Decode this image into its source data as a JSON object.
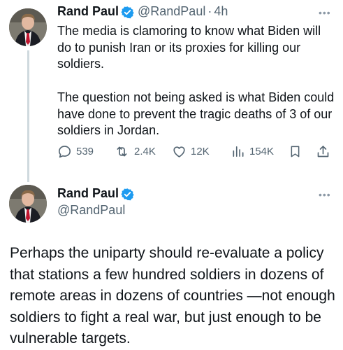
{
  "tweet1": {
    "name": "Rand Paul",
    "handle": "@RandPaul",
    "separator": "·",
    "time": "4h",
    "more": "•••",
    "paragraphs": [
      "The media is clamoring to know what Biden will do to punish Iran or its proxies for killing our soldiers.",
      "The question not being asked is what Biden could have done to prevent the tragic deaths of 3 of our soldiers in Jordan."
    ],
    "actions": {
      "replies": "539",
      "reposts": "2.4K",
      "likes": "12K",
      "views": "154K"
    }
  },
  "tweet2": {
    "name": "Rand Paul",
    "handle": "@RandPaul",
    "more": "•••",
    "text": "Perhaps the uniparty should re-evaluate a policy that stations a few hundred soldiers in dozens of remote areas in dozens of countries —not enough soldiers to fight a real war, but just enough to be vulnerable targets."
  },
  "colors": {
    "verified": "#1d9bf0",
    "text": "#0f1419",
    "secondary": "#536471",
    "thread": "#cfd9de"
  },
  "icons": [
    "verified-badge-icon",
    "reply-icon",
    "repost-icon",
    "like-icon",
    "views-icon",
    "bookmark-icon",
    "share-icon",
    "more-icon"
  ]
}
